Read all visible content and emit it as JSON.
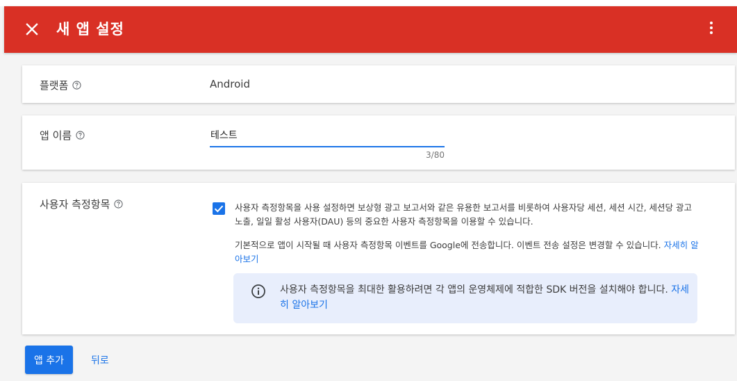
{
  "header": {
    "title": "새 앱 설정",
    "close_icon": "close-icon",
    "more_icon": "more-vert-icon",
    "background_color": "#d93025"
  },
  "platform": {
    "label": "플랫폼",
    "value": "Android"
  },
  "app_name": {
    "label": "앱 이름",
    "value": "테스트",
    "counter": "3/80"
  },
  "user_metrics": {
    "label": "사용자 측정항목",
    "checked": true,
    "description": "사용자 측정항목을 사용 설정하면 보상형 광고 보고서와 같은 유용한 보고서를 비롯하여 사용자당 세션, 세션 시간, 세션당 광고 노출, 일일 활성 사용자(DAU) 등의 중요한 사용자 측정항목을 이용할 수 있습니다.",
    "default_text": "기본적으로 앱이 시작될 때 사용자 측정항목 이벤트를 Google에 전송합니다. 이벤트 전송 설정은 변경할 수 있습니다.",
    "learn_more": "자세히 알아보기",
    "info_text": "사용자 측정항목을 최대한 활용하려면 각 앱의 운영체제에 적합한 SDK 버전을 설치해야 합니다.",
    "info_learn_more": "자세히 알아보기"
  },
  "footer": {
    "add_app_label": "앱 추가",
    "back_label": "뒤로"
  },
  "colors": {
    "accent": "#1a73e8",
    "info_background": "#e8eefc"
  }
}
